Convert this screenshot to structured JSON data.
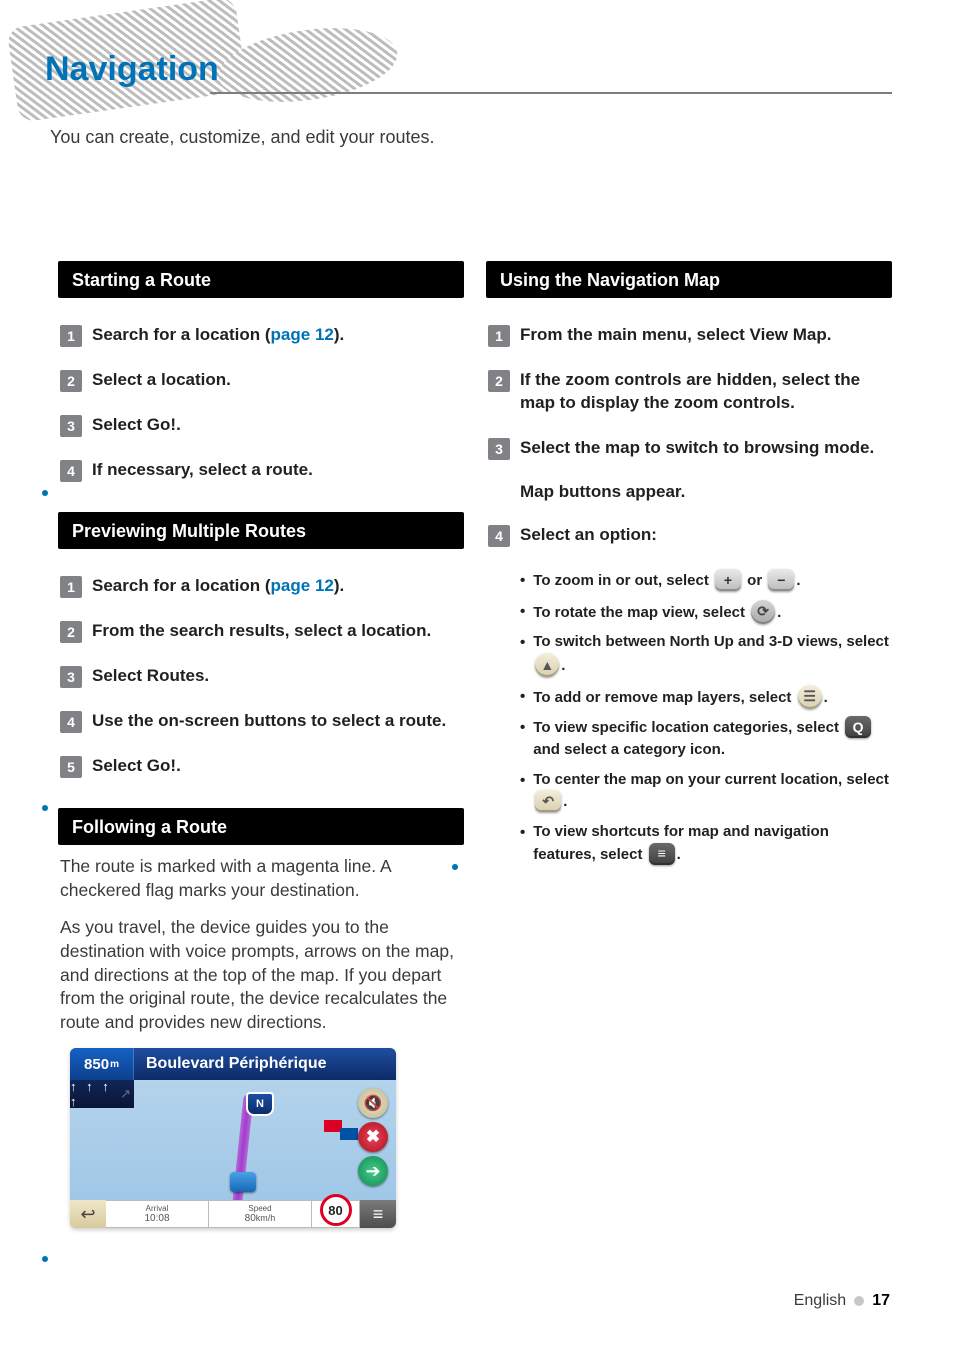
{
  "head": {
    "title": "Navigation"
  },
  "intro": "You can create, customize, and edit your routes.",
  "left": {
    "starting": {
      "heading": "Starting a Route",
      "steps": [
        {
          "pre": "Search for a location (",
          "link": "page 12",
          "post": ")."
        },
        {
          "text": "Select a location."
        },
        {
          "text": "Select Go!."
        },
        {
          "text": "If necessary, select a route."
        }
      ]
    },
    "preview": {
      "heading": "Previewing Multiple Routes",
      "steps": [
        {
          "pre": "Search for a location (",
          "link": "page 12",
          "post": ")."
        },
        {
          "text": "From the search results, select a location."
        },
        {
          "text": "Select Routes."
        },
        {
          "text": "Use the on-screen buttons to select a route."
        },
        {
          "text": "Select Go!."
        }
      ]
    },
    "follow": {
      "heading": "Following a Route",
      "p1": "The route is marked with a magenta line. A checkered flag marks your destination.",
      "p2": "As you travel, the device guides you to the destination with voice prompts, arrows on the map, and directions at the top of the map. If you depart from the original route, the device recalculates the route and provides new directions."
    }
  },
  "right": {
    "navmap": {
      "heading": "Using the Navigation Map",
      "steps": [
        {
          "text": "From the main menu, select View Map."
        },
        {
          "text": "If the zoom controls are hidden, select the map to display the zoom controls."
        },
        {
          "text": "Select the map to switch to browsing mode."
        },
        {
          "note": "Map buttons appear."
        },
        {
          "text": "Select an option:"
        }
      ],
      "options": [
        {
          "pre": "To zoom in or out, select ",
          "icon1": "plus",
          "mid": " or ",
          "icon2": "minus",
          "post": "."
        },
        {
          "pre": "To rotate the map view, select ",
          "icon1": "rotate",
          "post": "."
        },
        {
          "pre": "To switch between North Up and 3-D views, select ",
          "icon1": "compass",
          "post": "."
        },
        {
          "pre": "To add or remove map layers, select ",
          "icon1": "layers",
          "post": "."
        },
        {
          "pre": "To view specific location categories, select ",
          "icon1": "search",
          "post": " and select a category icon."
        },
        {
          "pre": "To center the map on your current location, select ",
          "icon1": "back",
          "post": "."
        },
        {
          "pre": "To view shortcuts for map and navigation features, select ",
          "icon1": "menu",
          "post": "."
        }
      ]
    }
  },
  "shot": {
    "dist": "850",
    "dist_unit": "m",
    "road": "Boulevard Périphérique",
    "shield": "N",
    "arrival_label": "Arrival",
    "arrival": "10:08",
    "speed_label": "Speed",
    "speed_val": "80",
    "speed_unit": "km/h",
    "limit": "80"
  },
  "footer": {
    "lang": "English",
    "page": "17"
  },
  "icons": {
    "plus": "+",
    "minus": "−",
    "rotate": "⟳",
    "compass": "▲",
    "layers": "☰",
    "search": "Q",
    "back": "↶",
    "menu": "≡",
    "mute": "🔇",
    "stop": "✖",
    "go": "➔",
    "back_arrow": "↩"
  }
}
